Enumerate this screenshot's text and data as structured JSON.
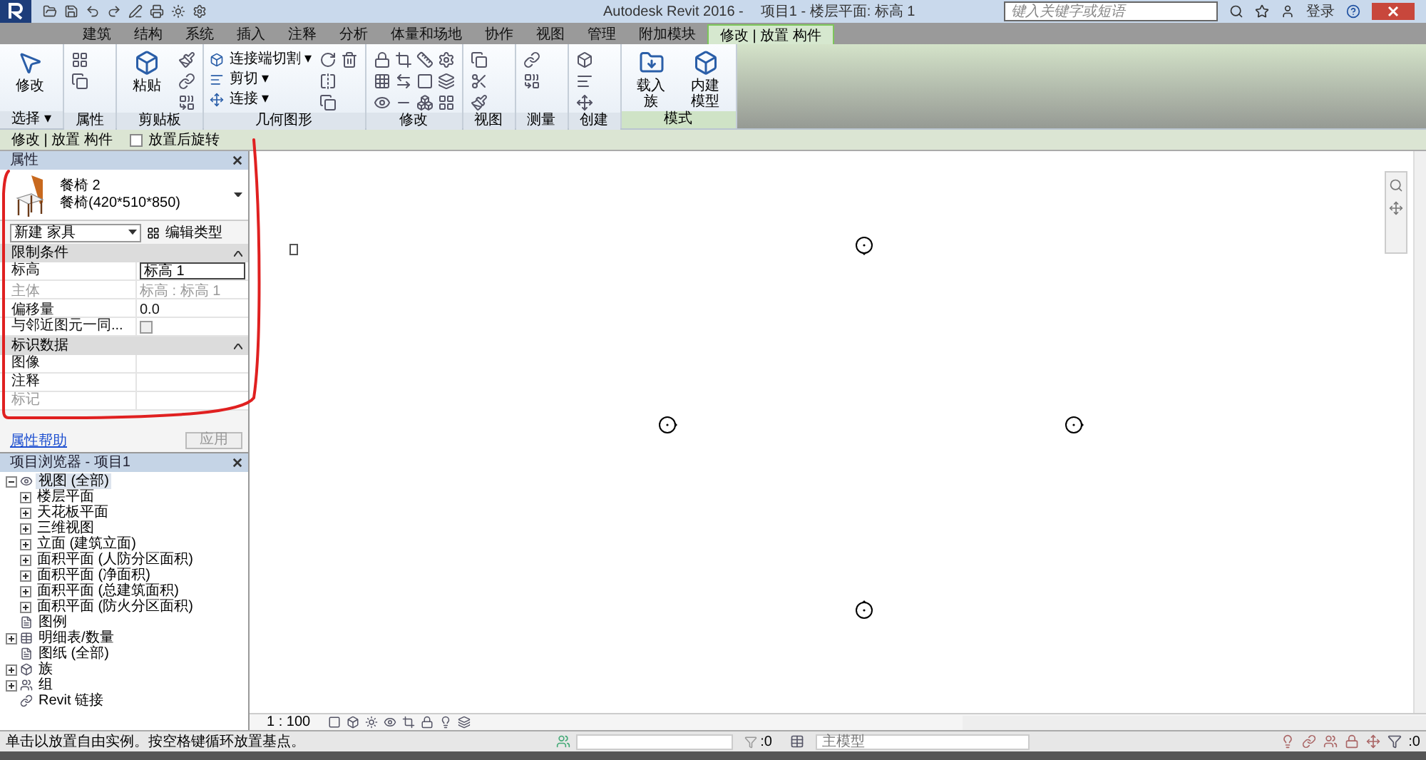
{
  "title_bar": {
    "app_title": "Autodesk Revit 2016 -",
    "document_title": "项目1 - 楼层平面: 标高 1",
    "search": {
      "placeholder": "键入关键字或短语"
    },
    "sign_in": "登录"
  },
  "tabs": [
    {
      "label": "建筑",
      "selected": false
    },
    {
      "label": "结构",
      "selected": false
    },
    {
      "label": "系统",
      "selected": false
    },
    {
      "label": "插入",
      "selected": false
    },
    {
      "label": "注释",
      "selected": false
    },
    {
      "label": "分析",
      "selected": false
    },
    {
      "label": "体量和场地",
      "selected": false
    },
    {
      "label": "协作",
      "selected": false
    },
    {
      "label": "视图",
      "selected": false
    },
    {
      "label": "管理",
      "selected": false
    },
    {
      "label": "附加模块",
      "selected": false
    },
    {
      "label": "修改 | 放置 构件",
      "selected": true
    }
  ],
  "ribbon_panels": [
    {
      "label": "选择 ▾",
      "tools": [
        {
          "kind": "large",
          "label": "修改"
        }
      ]
    },
    {
      "label": "属性",
      "tools": [
        {
          "kind": "icon"
        },
        {
          "kind": "icon"
        }
      ]
    },
    {
      "label": "剪贴板",
      "tools": [
        {
          "kind": "large",
          "label": "粘贴"
        },
        {
          "kind": "icon"
        },
        {
          "kind": "icon"
        },
        {
          "kind": "icon"
        }
      ]
    },
    {
      "label": "几何图形",
      "tools": [
        {
          "kind": "small",
          "label": "连接端切割 ▾"
        },
        {
          "kind": "small",
          "label": "剪切 ▾"
        },
        {
          "kind": "small",
          "label": "连接 ▾"
        },
        {
          "kind": "icon"
        },
        {
          "kind": "icon"
        },
        {
          "kind": "icon"
        },
        {
          "kind": "icon"
        }
      ]
    },
    {
      "label": "修改",
      "tools": [
        {
          "kind": "icon"
        },
        {
          "kind": "icon"
        },
        {
          "kind": "icon"
        },
        {
          "kind": "icon"
        },
        {
          "kind": "icon"
        },
        {
          "kind": "icon"
        },
        {
          "kind": "icon"
        },
        {
          "kind": "icon"
        },
        {
          "kind": "icon"
        },
        {
          "kind": "icon"
        },
        {
          "kind": "icon"
        },
        {
          "kind": "icon"
        }
      ]
    },
    {
      "label": "视图",
      "tools": [
        {
          "kind": "icon"
        },
        {
          "kind": "icon"
        },
        {
          "kind": "icon"
        }
      ]
    },
    {
      "label": "测量",
      "tools": [
        {
          "kind": "icon"
        },
        {
          "kind": "icon"
        }
      ]
    },
    {
      "label": "创建",
      "tools": [
        {
          "kind": "icon"
        },
        {
          "kind": "icon"
        },
        {
          "kind": "icon"
        }
      ]
    },
    {
      "label": "模式",
      "tools": [
        {
          "kind": "large",
          "label": "载入族"
        },
        {
          "kind": "large",
          "label": "内建模型"
        }
      ]
    }
  ],
  "options_bar": {
    "context": "修改 | 放置 构件",
    "rotate_after_placing": {
      "label": "放置后旋转",
      "checked": false
    }
  },
  "properties": {
    "title": "属性",
    "type_name": "餐椅 2",
    "type_size": "餐椅(420*510*850)",
    "category": "新建 家具",
    "edit_type": "编辑类型",
    "groups": [
      {
        "name": "限制条件",
        "rows": [
          {
            "label": "标高",
            "value": "标高 1",
            "kind": "input",
            "disabled": false
          },
          {
            "label": "主体",
            "value": "标高 : 标高 1",
            "kind": "text",
            "disabled": true
          },
          {
            "label": "偏移量",
            "value": "0.0",
            "kind": "text",
            "disabled": false
          },
          {
            "label": "与邻近图元一同...",
            "kind": "checkbox",
            "checked": false,
            "disabled": false
          }
        ]
      },
      {
        "name": "标识数据",
        "rows": [
          {
            "label": "图像",
            "kind": "text",
            "disabled": false
          },
          {
            "label": "注释",
            "kind": "text",
            "disabled": false
          },
          {
            "label": "标记",
            "kind": "text",
            "disabled": true
          }
        ]
      }
    ],
    "help_link": "属性帮助",
    "apply_button": {
      "label": "应用",
      "disabled": true
    }
  },
  "project_browser": {
    "title": "项目浏览器 - 项目1",
    "tree": [
      {
        "label": "视图 (全部)",
        "expanded": true,
        "selected": true,
        "children": [
          {
            "label": "楼层平面",
            "expanded": false
          },
          {
            "label": "天花板平面",
            "expanded": false
          },
          {
            "label": "三维视图",
            "expanded": false
          },
          {
            "label": "立面 (建筑立面)",
            "expanded": false
          },
          {
            "label": "面积平面 (人防分区面积)",
            "expanded": false
          },
          {
            "label": "面积平面 (净面积)",
            "expanded": false
          },
          {
            "label": "面积平面 (总建筑面积)",
            "expanded": false
          },
          {
            "label": "面积平面 (防火分区面积)",
            "expanded": false
          }
        ]
      },
      {
        "label": "图例",
        "selected": false
      },
      {
        "label": "明细表/数量",
        "expanded": false,
        "selected": false
      },
      {
        "label": "图纸 (全部)",
        "selected": false
      },
      {
        "label": "族",
        "expanded": false,
        "selected": false
      },
      {
        "label": "组",
        "expanded": false,
        "selected": false
      },
      {
        "label": "Revit 链接",
        "selected": false
      }
    ]
  },
  "view_bar": {
    "scale": "1 : 100"
  },
  "status_bar": {
    "message": "单击以放置自由实例。按空格键循环放置基点。",
    "selection_count": ":0",
    "workset": "主模型",
    "filter_count": ":0"
  }
}
